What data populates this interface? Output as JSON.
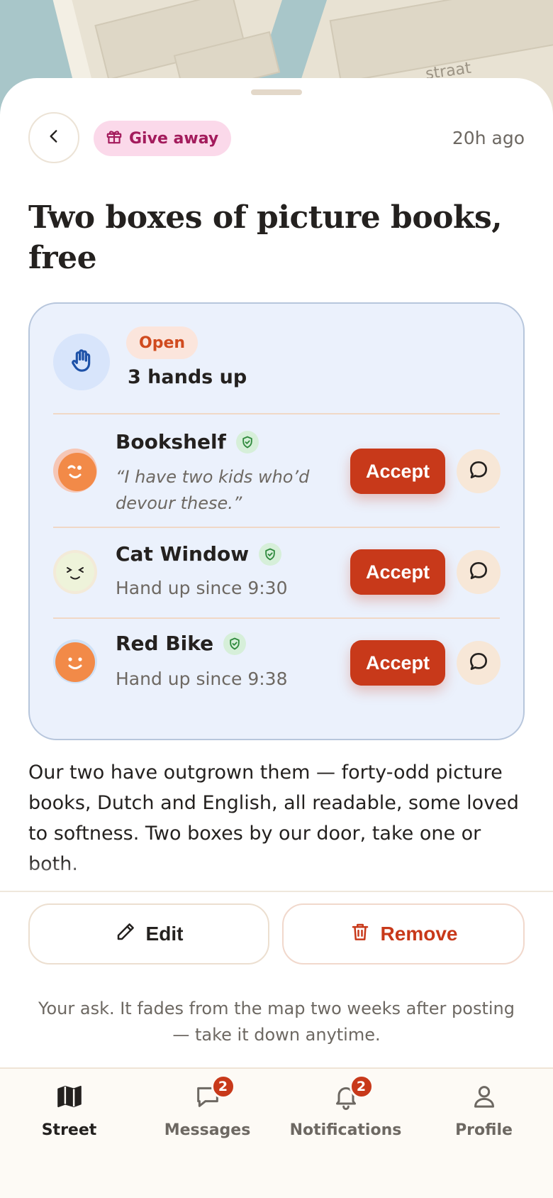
{
  "map": {
    "street_label": "straat"
  },
  "header": {
    "tag_label": "Give away",
    "tag_icon": "gift-icon",
    "time_ago": "20h ago",
    "back_icon": "chevron-left-icon"
  },
  "post": {
    "title": "Two boxes of picture books, free"
  },
  "hands_panel": {
    "status": "Open",
    "count_label": "3 hands up",
    "icon": "raised-hand-icon",
    "requests": [
      {
        "name": "Bookshelf",
        "quote": "“I have two kids who’d devour these.”",
        "accept_label": "Accept",
        "avatar_color": "#f28a48"
      },
      {
        "name": "Cat Window",
        "subtitle": "Hand up since 9:30",
        "accept_label": "Accept",
        "avatar_color": "#eaf1d8"
      },
      {
        "name": "Red Bike",
        "subtitle": "Hand up since 9:38",
        "accept_label": "Accept",
        "avatar_color": "#f28a48"
      }
    ]
  },
  "description": "Our two have outgrown them — forty-odd picture books, Dutch and English, all readable, some loved to softness. Two boxes by our door, take one or both.",
  "actions": {
    "edit_label": "Edit",
    "remove_label": "Remove"
  },
  "note": "Your ask. It fades from the map two weeks after posting — take it down anytime.",
  "tabbar": {
    "tabs": [
      {
        "label": "Street",
        "icon": "map-icon",
        "active": true
      },
      {
        "label": "Messages",
        "icon": "chat-bubble-icon",
        "badge": "2"
      },
      {
        "label": "Notifications",
        "icon": "bell-icon",
        "badge": "2"
      },
      {
        "label": "Profile",
        "icon": "person-icon"
      }
    ]
  },
  "colors": {
    "accent": "#c8391a",
    "panel_bg": "#ebf1fc",
    "giveaway_bg": "#fbd9ea",
    "giveaway_text": "#a31b5c",
    "verified": "#2f8a3d"
  }
}
